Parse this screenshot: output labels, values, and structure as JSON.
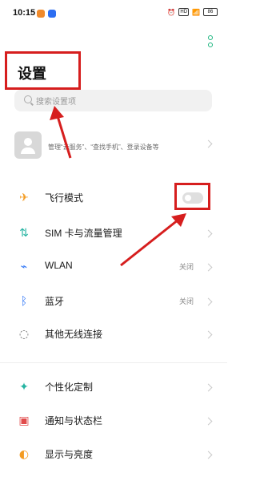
{
  "status_bar": {
    "time": "10:15",
    "indicators": "⏰ HD ²⁴G ᵢₗ",
    "battery": "86"
  },
  "header": {
    "title": "设置"
  },
  "search": {
    "placeholder": "搜索设置项"
  },
  "account": {
    "subtitle": "管理“云服务”、“查找手机”、登录设备等"
  },
  "settings": {
    "airplane": {
      "label": "飞行模式",
      "icon": "airplane-icon"
    },
    "sim": {
      "label": "SIM 卡与流量管理",
      "icon": "sim-data-icon"
    },
    "wlan": {
      "label": "WLAN",
      "value": "关闭",
      "icon": "wifi-icon"
    },
    "bluetooth": {
      "label": "蓝牙",
      "value": "关闭",
      "icon": "bluetooth-icon"
    },
    "other_wireless": {
      "label": "其他无线连接",
      "icon": "wireless-connection-icon"
    },
    "personalization": {
      "label": "个性化定制",
      "icon": "palette-icon"
    },
    "notifications": {
      "label": "通知与状态栏",
      "icon": "notification-icon"
    },
    "display": {
      "label": "显示与亮度",
      "icon": "brightness-icon"
    }
  },
  "colors": {
    "highlight_red": "#d61e1e",
    "accent_green": "#1fb680",
    "accent_blue": "#2e75f6"
  }
}
